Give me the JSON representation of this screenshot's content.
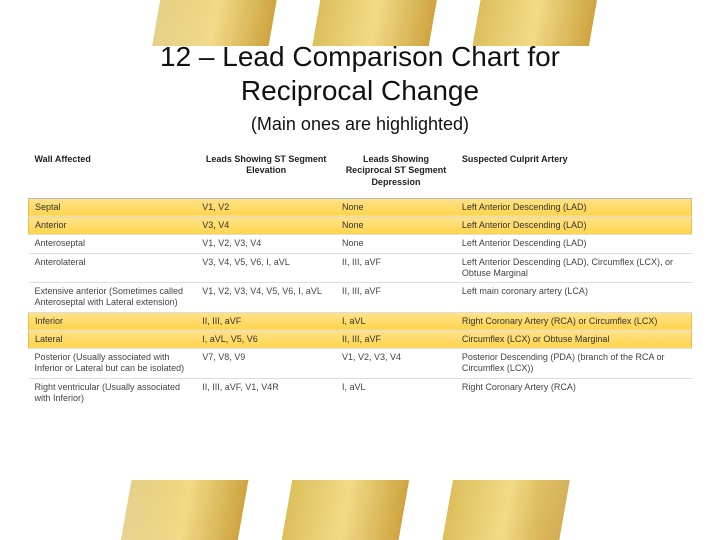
{
  "title_line1": "12 – Lead Comparison Chart for",
  "title_line2": "Reciprocal Change",
  "subtitle": "(Main ones are highlighted)",
  "headers": {
    "wall": "Wall Affected",
    "elevation": "Leads Showing ST Segment Elevation",
    "depression": "Leads Showing Reciprocal ST Segment Depression",
    "artery": "Suspected Culprit Artery"
  },
  "rows": [
    {
      "wall": "Septal",
      "elevation": "V1, V2",
      "depression": "None",
      "artery": "Left Anterior Descending (LAD)",
      "highlight": true,
      "orange": true
    },
    {
      "wall": "Anterior",
      "elevation": "V3, V4",
      "depression": "None",
      "artery": "Left Anterior Descending (LAD)",
      "highlight": true
    },
    {
      "wall": "Anteroseptal",
      "elevation": "V1, V2, V3, V4",
      "depression": "None",
      "artery": "Left Anterior Descending (LAD)"
    },
    {
      "wall": "Anterolateral",
      "elevation": "V3, V4, V5, V6, I, aVL",
      "depression": "II, III, aVF",
      "artery": "Left Anterior Descending (LAD), Circumflex (LCX), or Obtuse Marginal"
    },
    {
      "wall": "Extensive anterior (Sometimes called Anteroseptal with Lateral extension)",
      "elevation": "V1, V2, V3, V4, V5, V6, I, aVL",
      "depression": "II, III, aVF",
      "artery": "Left main coronary artery (LCA)"
    },
    {
      "wall": "Inferior",
      "elevation": "II, III, aVF",
      "depression": "I, aVL",
      "artery": "Right Coronary Artery (RCA) or Circumflex (LCX)",
      "highlight": true,
      "orange": true
    },
    {
      "wall": "Lateral",
      "elevation": "I, aVL, V5, V6",
      "depression": "II, III, aVF",
      "artery": "Circumflex (LCX) or Obtuse Marginal",
      "highlight": true
    },
    {
      "wall": "Posterior (Usually associated with Inferior or Lateral but can be isolated)",
      "elevation": "V7, V8, V9",
      "depression": "V1, V2, V3, V4",
      "artery": "Posterior Descending (PDA) (branch of the RCA or Circumflex (LCX))"
    },
    {
      "wall": "Right ventricular (Usually associated with Inferior)",
      "elevation": "II, III, aVF, V1, V4R",
      "depression": "I, aVL",
      "artery": "Right Coronary Artery (RCA)"
    }
  ]
}
